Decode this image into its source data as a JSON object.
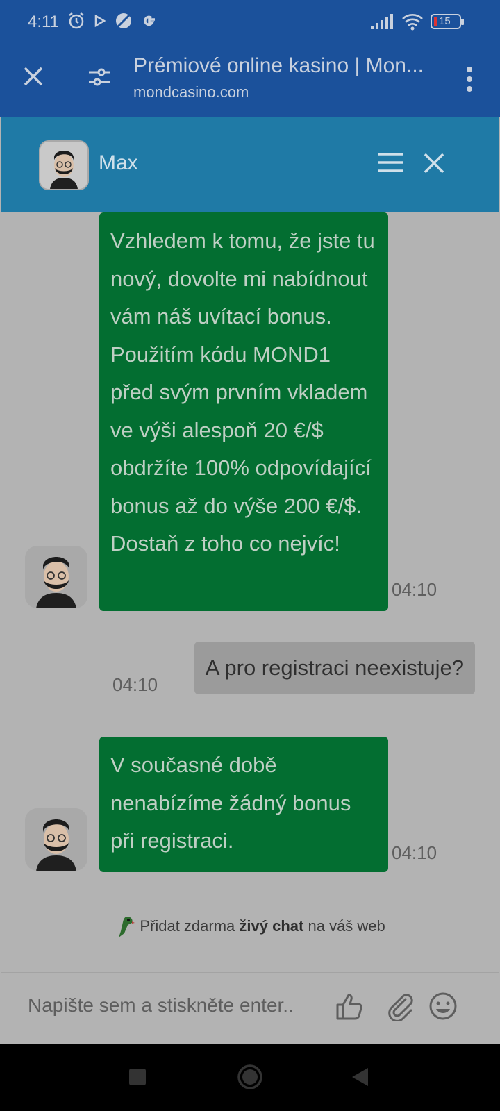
{
  "status_bar": {
    "time": "4:11",
    "battery": "15",
    "icons": [
      "alarm-icon",
      "play-icon",
      "no-data-icon",
      "google-icon",
      "signal-icon",
      "wifi-icon",
      "battery-icon"
    ]
  },
  "browser": {
    "title": "Prémiové online kasino | Mon...",
    "url": "mondcasino.com"
  },
  "chat": {
    "agent_name": "Max",
    "messages": [
      {
        "from": "agent",
        "text": "Vzhledem k tomu, že jste tu nový, dovolte mi nabídnout vám náš uvítací bonus. Použitím kódu MOND1 před svým prvním vkladem ve výši alespoň 20 €/$ obdržíte 100% odpovídající bonus až do výše 200 €/$. Dostaň z toho co nejvíc!",
        "time": "04:10"
      },
      {
        "from": "user",
        "text": "A pro registraci neexistuje?",
        "time": "04:10"
      },
      {
        "from": "agent",
        "text": "V současné době nenabízíme žádný bonus při registraci.",
        "time": "04:10"
      }
    ],
    "promo": {
      "prefix": "Přidat zdarma",
      "bold": "živý chat",
      "suffix": "na váš web"
    },
    "input_placeholder": "Napište sem a stiskněte enter.."
  },
  "colors": {
    "browser_bar": "#1b519b",
    "chat_header": "#1f7aa6",
    "agent_bubble": "#036e31",
    "user_bubble": "#9b9b9b"
  }
}
